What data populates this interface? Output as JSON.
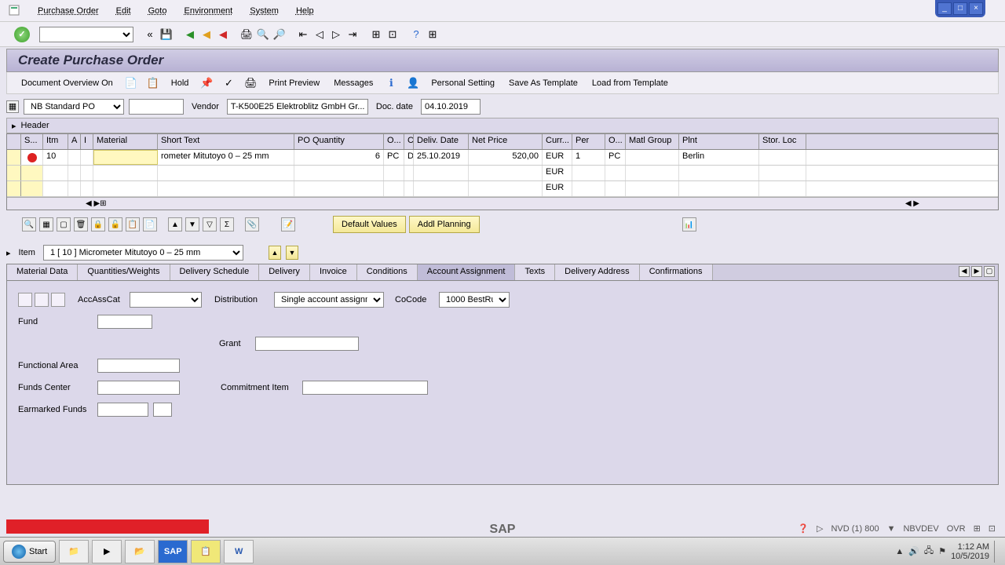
{
  "menu": {
    "items": [
      "Purchase Order",
      "Edit",
      "Goto",
      "Environment",
      "System",
      "Help"
    ]
  },
  "title": "Create Purchase Order",
  "actions": {
    "overview": "Document Overview On",
    "hold": "Hold",
    "print_preview": "Print Preview",
    "messages": "Messages",
    "personal": "Personal Setting",
    "save_template": "Save As Template",
    "load_template": "Load from Template"
  },
  "header": {
    "doctype_label": "NB Standard PO",
    "vendor_label": "Vendor",
    "vendor_value": "T-K500E25 Elektroblitz GmbH Gr...",
    "docdate_label": "Doc. date",
    "docdate_value": "04.10.2019",
    "header_toggle": "Header"
  },
  "grid": {
    "cols": [
      "S...",
      "Itm",
      "A",
      "I",
      "Material",
      "Short Text",
      "PO Quantity",
      "O...",
      "C",
      "Deliv. Date",
      "Net Price",
      "Curr...",
      "Per",
      "O...",
      "Matl Group",
      "Plnt",
      "Stor. Loc"
    ],
    "rows": [
      {
        "itm": "10",
        "short": "rometer Mitutoyo 0 – 25 mm",
        "qty": "6",
        "uom": "PC",
        "c": "D",
        "deliv": "25.10.2019",
        "price": "520,00",
        "curr": "EUR",
        "per": "1",
        "ouom": "PC",
        "plnt": "Berlin"
      },
      {
        "curr": "EUR"
      },
      {
        "curr": "EUR"
      }
    ]
  },
  "grid_buttons": {
    "default": "Default Values",
    "addl": "Addl Planning"
  },
  "item": {
    "label": "Item",
    "value": "1 [ 10 ] Micrometer Mitutoyo 0 – 25 mm"
  },
  "tabs": [
    "Material Data",
    "Quantities/Weights",
    "Delivery Schedule",
    "Delivery",
    "Invoice",
    "Conditions",
    "Account Assignment",
    "Texts",
    "Delivery Address",
    "Confirmations"
  ],
  "active_tab": 6,
  "acct": {
    "accasscat": "AccAssCat",
    "distribution": "Distribution",
    "distribution_value": "Single account assignm..",
    "cocode": "CoCode",
    "cocode_value": "1000 BestRu..",
    "fund": "Fund",
    "grant": "Grant",
    "func_area": "Functional Area",
    "funds_center": "Funds Center",
    "commitment": "Commitment Item",
    "earmarked": "Earmarked Funds"
  },
  "statusbar": {
    "sys": "NVD (1) 800",
    "srv": "NBVDEV",
    "mode": "OVR"
  },
  "taskbar": {
    "start": "Start",
    "time": "1:12 AM",
    "date": "10/5/2019"
  },
  "sap": "SAP"
}
